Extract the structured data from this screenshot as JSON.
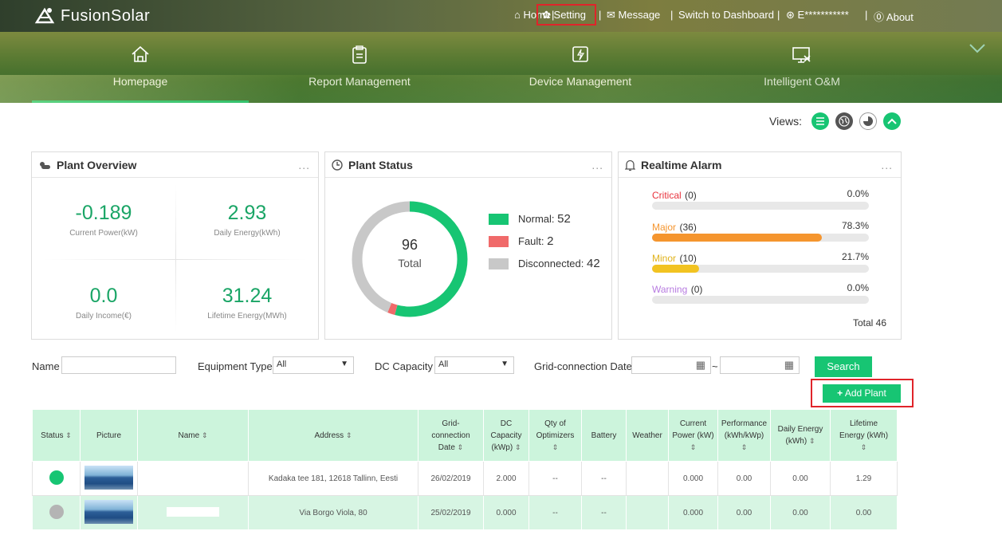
{
  "brand": {
    "name": "FusionSolar"
  },
  "topnav": {
    "home": "Home",
    "setting": "Setting",
    "message": "Message",
    "switch": "Switch to Dashboard",
    "user": "E***********",
    "about": "About",
    "sep": "|"
  },
  "menu": [
    {
      "label": "Homepage",
      "icon": "house-icon"
    },
    {
      "label": "Report Management",
      "icon": "report-icon"
    },
    {
      "label": "Device Management",
      "icon": "device-icon"
    },
    {
      "label": "Intelligent O&M",
      "icon": "om-icon"
    }
  ],
  "views": {
    "label": "Views:"
  },
  "overview": {
    "title": "Plant Overview",
    "dots": "...",
    "current_power": {
      "value": "-0.189",
      "label": "Current Power(kW)"
    },
    "daily_energy": {
      "value": "2.93",
      "label": "Daily Energy(kWh)"
    },
    "daily_income": {
      "value": "0.0",
      "label": "Daily Income(€)"
    },
    "lifetime_energy": {
      "value": "31.24",
      "label": "Lifetime Energy(MWh)"
    }
  },
  "status": {
    "title": "Plant Status",
    "dots": "...",
    "total": "96",
    "total_label": "Total",
    "normal_label": "Normal:",
    "normal": "52",
    "fault_label": "Fault:",
    "fault": "2",
    "disc_label": "Disconnected:",
    "disc": "42",
    "colors": {
      "normal": "#17c573",
      "fault": "#f06a6a",
      "disc": "#c8c8c8"
    }
  },
  "alarm": {
    "title": "Realtime Alarm",
    "dots": "...",
    "critical": {
      "label": "Critical",
      "count": "(0)",
      "pct": "0.0%",
      "color": "#e8333d",
      "fraction": 0.0
    },
    "major": {
      "label": "Major",
      "count": "(36)",
      "pct": "78.3%",
      "color": "#f5952e",
      "fraction": 0.783
    },
    "minor": {
      "label": "Minor",
      "count": "(10)",
      "pct": "21.7%",
      "color": "#f2c321",
      "fraction": 0.217
    },
    "warning": {
      "label": "Warning",
      "count": "(0)",
      "pct": "0.0%",
      "color": "#b77be0",
      "fraction": 0.0
    },
    "total": "Total 46"
  },
  "filters": {
    "name": "Name",
    "equip": "Equipment Type",
    "equip_val": "All",
    "dc": "DC Capacity",
    "dc_val": "All",
    "grid": "Grid-connection Date",
    "tilde": "~",
    "search": "Search",
    "add": "Add Plant"
  },
  "table": {
    "headers": {
      "status": "Status",
      "picture": "Picture",
      "name": "Name",
      "address": "Address",
      "grid1": "Grid-",
      "grid2": "connection",
      "grid3": "Date",
      "dc1": "DC",
      "dc2": "Capacity",
      "dc3": "(kWp)",
      "qty1": "Qty of",
      "qty2": "Optimizers",
      "battery": "Battery",
      "weather": "Weather",
      "cp1": "Current",
      "cp2": "Power (kW)",
      "perf1": "Performance",
      "perf2": "(kWh/kWp)",
      "de1": "Daily Energy",
      "de2": "(kWh)",
      "le1": "Lifetime",
      "le2": "Energy (kWh)"
    },
    "rows": [
      {
        "status_color": "#17c573",
        "address": "Kadaka tee 181, 12618 Tallinn, Eesti",
        "date": "26/02/2019",
        "dc": "2.000",
        "qty": "--",
        "battery": "--",
        "weather": "",
        "cp": "0.000",
        "perf": "0.00",
        "de": "0.00",
        "le": "1.29"
      },
      {
        "status_color": "#b4b4b4",
        "address": "Via Borgo Viola, 80",
        "date": "25/02/2019",
        "dc": "0.000",
        "qty": "--",
        "battery": "--",
        "weather": "",
        "cp": "0.000",
        "perf": "0.00",
        "de": "0.00",
        "le": "0.00"
      }
    ]
  }
}
